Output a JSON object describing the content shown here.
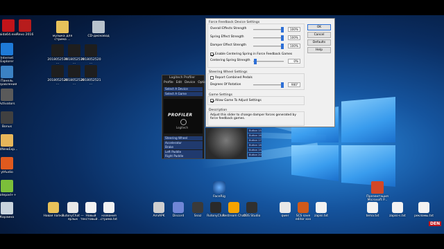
{
  "desktop": {
    "left_icons": [
      {
        "label": "aida64.exe",
        "icon": "aida64-icon",
        "color": "#c0141a"
      },
      {
        "label": "Revo 2016",
        "icon": "revo-icon",
        "color": "#b71c1c"
      },
      {
        "label": "Internet Explorer",
        "icon": "ie-icon",
        "color": "#1e7ad8"
      },
      {
        "label": "Панель управления",
        "icon": "control-panel-icon",
        "color": "#3b82c4"
      },
      {
        "label": "Activators",
        "icon": "activators-icon",
        "color": "#5a5a5a"
      },
      {
        "label": "Bonus",
        "icon": "bonus-icon",
        "color": "#404040"
      },
      {
        "label": "OldNewExp...",
        "icon": "oldnewexplorer-icon",
        "color": "#e7b65a"
      },
      {
        "label": "ytAudio",
        "icon": "ytaudio-icon",
        "color": "#e05a1e"
      },
      {
        "label": "Notepad++",
        "icon": "notepadpp-icon",
        "color": "#7bbf3a"
      },
      {
        "label": "Корзина",
        "icon": "recycle-bin-icon",
        "color": "#c8d3de"
      }
    ],
    "folder_icons": [
      {
        "label": "музыка для стрима ...",
        "icon": "folder-icon"
      },
      {
        "label": "CD-дисковод",
        "icon": "cd-drive-icon"
      }
    ],
    "thumb_icons": [
      {
        "label": "2018052519..."
      },
      {
        "label": "2018052519..."
      },
      {
        "label": "2018052520..."
      },
      {
        "label": "2018052520..."
      },
      {
        "label": "2018052520..."
      },
      {
        "label": "2018052521..."
      }
    ],
    "bottom_icons": [
      {
        "label": "Новая папка",
        "icon": "folder-icon",
        "color": "#e7c15a"
      },
      {
        "label": "RutonyChat — ярлык",
        "icon": "file-icon",
        "color": "#e8e8e8"
      },
      {
        "label": "Новый текстовый ...",
        "icon": "text-file-icon",
        "color": "#f2f2f2"
      },
      {
        "label": "названия стрима.txt",
        "icon": "text-file-icon",
        "color": "#f2f2f2"
      },
      {
        "label": "AmiAPK",
        "icon": "amiapk-icon",
        "color": "#cfcfcf"
      },
      {
        "label": "Discord",
        "icon": "discord-icon",
        "color": "#6f86d6"
      },
      {
        "label": "Snaz",
        "icon": "snaz-icon",
        "color": "#3a3a3a"
      },
      {
        "label": "RutonyChat",
        "icon": "rutonychat-icon",
        "color": "#2a2a2a"
      },
      {
        "label": "Restream Chat",
        "icon": "restream-icon",
        "color": "#f4a300"
      },
      {
        "label": "OBS Studio",
        "icon": "obs-icon",
        "color": "#303030"
      },
      {
        "label": "qwer",
        "icon": "file-icon",
        "color": "#e8e8e8"
      },
      {
        "label": "SCS save editor xxx",
        "icon": "scs-editor-icon",
        "color": "#d05a1a"
      },
      {
        "label": "zapisi.txt",
        "icon": "text-file-icon",
        "color": "#f2f2f2"
      },
      {
        "label": "tema.txt",
        "icon": "text-file-icon",
        "color": "#f2f2f2"
      },
      {
        "label": "zapisi-s.txt",
        "icon": "text-file-icon",
        "color": "#f2f2f2"
      },
      {
        "label": "рекламы.txt",
        "icon": "text-file-icon",
        "color": "#f2f2f2"
      }
    ],
    "faceig_label": "FaceRig",
    "ms_shortcut_label": "Презентация Microsoft P...",
    "watermark": "DEN"
  },
  "profiler": {
    "title": "Logitech Profiler",
    "menu": [
      "Profile",
      "Edit",
      "Device",
      "Options"
    ],
    "list": [
      "Select A Device",
      "Select A Game"
    ],
    "logo": "PROFILER",
    "brand": "Logitech",
    "controls": [
      "Steering Wheel",
      "Accelerator",
      "Brake",
      "Left Paddle",
      "Right Paddle"
    ],
    "buttons": [
      "Button 15",
      "Button 16",
      "Button 17",
      "Button 18",
      "Button 19",
      "Button 20"
    ]
  },
  "dialog": {
    "ff_group": "Force Feedback Device Settings",
    "sliders": [
      {
        "label": "Overall Effects Strength",
        "value": "100%",
        "level": 100
      },
      {
        "label": "Spring Effect Strength",
        "value": "100%",
        "level": 100
      },
      {
        "label": "Damper Effect Strength",
        "value": "100%",
        "level": 100
      }
    ],
    "centering_check": "Enable Centering Spring in Force Feedback Games",
    "centering_label": "Centering Spring Strength",
    "centering_value": "0%",
    "wheel_group": "Steering Wheel Settings",
    "combined_pedals": "Report Combined Pedals",
    "rotation_label": "Degrees Of Rotation",
    "rotation_value": "900°",
    "game_group": "Game Settings",
    "allow_game": "Allow Game To Adjust Settings",
    "desc_label": "Description",
    "desc_text": "Adjust this slider to change damper forces generated by force feedback games.",
    "buttons": {
      "ok": "OK",
      "cancel": "Cancel",
      "defaults": "Defaults",
      "help": "Help"
    }
  }
}
